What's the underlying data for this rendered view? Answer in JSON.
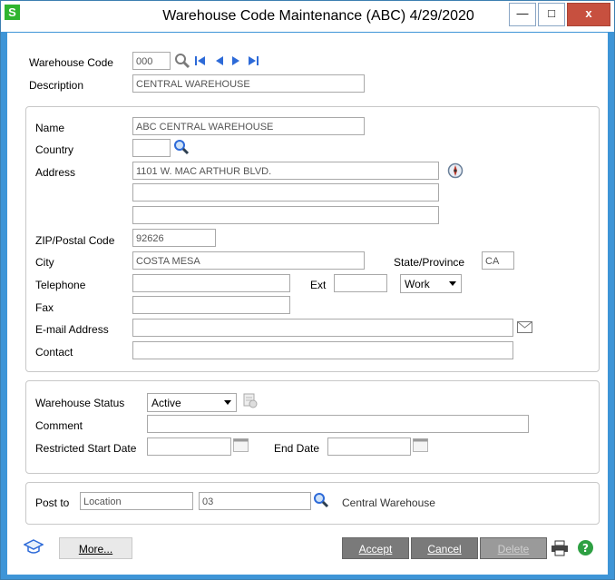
{
  "window": {
    "app_icon": "S",
    "title": "Warehouse Code Maintenance (ABC) 4/29/2020",
    "minimize": "—",
    "maximize": "□",
    "close": "x"
  },
  "header": {
    "warehouse_code_label": "Warehouse Code",
    "warehouse_code_value": "000",
    "description_label": "Description",
    "description_value": "CENTRAL WAREHOUSE"
  },
  "address": {
    "name_label": "Name",
    "name_value": "ABC CENTRAL WAREHOUSE",
    "country_label": "Country",
    "country_value": "",
    "address_label": "Address",
    "address_line1": "1101 W. MAC ARTHUR BLVD.",
    "address_line2": "",
    "address_line3": "",
    "zip_label": "ZIP/Postal Code",
    "zip_value": "92626",
    "city_label": "City",
    "city_value": "COSTA MESA",
    "state_label": "State/Province",
    "state_value": "CA",
    "telephone_label": "Telephone",
    "telephone_value": "",
    "ext_label": "Ext",
    "ext_value": "",
    "phone_type": "Work",
    "fax_label": "Fax",
    "fax_value": "",
    "email_label": "E-mail Address",
    "email_value": "",
    "contact_label": "Contact",
    "contact_value": ""
  },
  "status": {
    "status_label": "Warehouse Status",
    "status_value": "Active",
    "comment_label": "Comment",
    "comment_value": "",
    "restricted_start_label": "Restricted Start Date",
    "restricted_start_value": "",
    "end_date_label": "End Date",
    "end_date_value": ""
  },
  "post": {
    "post_to_label": "Post to",
    "post_to_type": "Location",
    "location_code": "03",
    "location_name": "Central Warehouse"
  },
  "footer": {
    "more_label": "More...",
    "accept_label": "Accept",
    "cancel_label": "Cancel",
    "delete_label": "Delete"
  },
  "icons": {
    "lookup": "magnifier-icon",
    "first": "first-record-icon",
    "prev": "previous-record-icon",
    "next": "next-record-icon",
    "last": "last-record-icon",
    "map": "compass-icon",
    "email": "envelope-icon",
    "calendar": "calendar-icon",
    "help": "help-icon",
    "print": "printer-icon",
    "education": "graduation-cap-icon"
  },
  "colors": {
    "window_border": "#3e95d7",
    "button_dark": "#7a7a7a",
    "close_button": "#c7503f",
    "help_green": "#2ea043"
  }
}
